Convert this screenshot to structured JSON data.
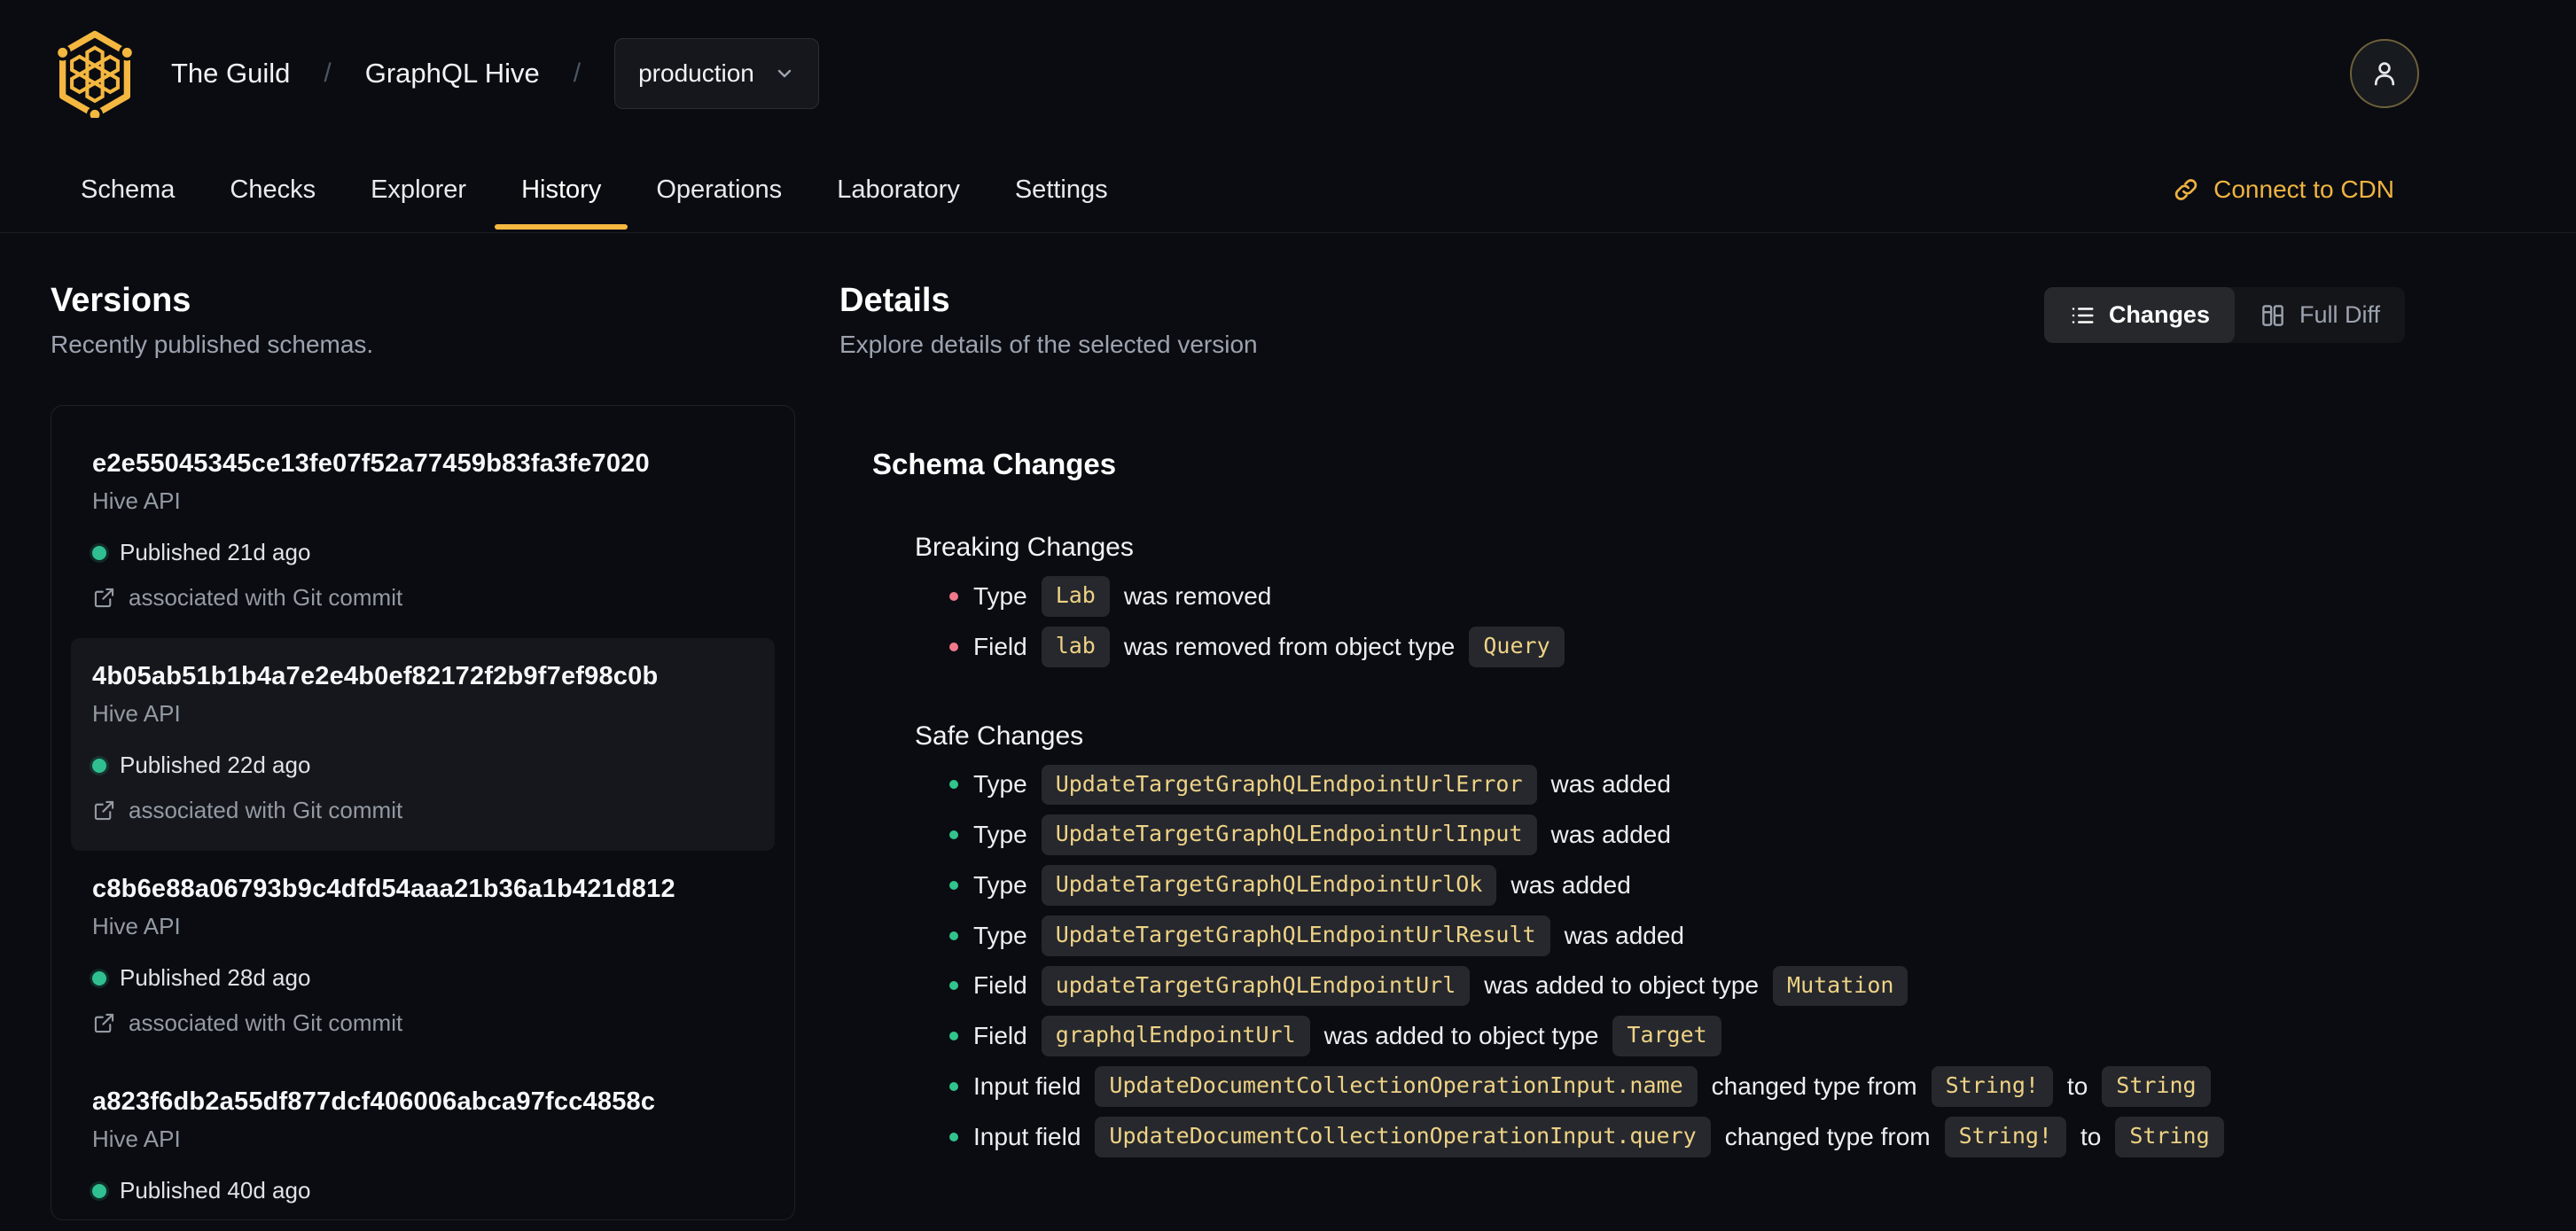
{
  "colors": {
    "accent": "#f4b740",
    "page_background": "#0a0c11",
    "breaking_bullet": "#f0788b",
    "safe_bullet": "#31c48d",
    "published_dot": "#2fbf90",
    "code_text": "#eed285",
    "code_background": "#26282d"
  },
  "header": {
    "breadcrumb": {
      "org": "The Guild",
      "separator": "/",
      "project": "GraphQL Hive",
      "target": "production"
    },
    "tabs": [
      {
        "id": "schema",
        "label": "Schema",
        "active": false
      },
      {
        "id": "checks",
        "label": "Checks",
        "active": false
      },
      {
        "id": "explorer",
        "label": "Explorer",
        "active": false
      },
      {
        "id": "history",
        "label": "History",
        "active": true
      },
      {
        "id": "operations",
        "label": "Operations",
        "active": false
      },
      {
        "id": "laboratory",
        "label": "Laboratory",
        "active": false
      },
      {
        "id": "settings",
        "label": "Settings",
        "active": false
      }
    ],
    "connect_cdn_label": "Connect to CDN"
  },
  "versions_panel": {
    "title": "Versions",
    "subtitle": "Recently published schemas.",
    "items": [
      {
        "hash": "e2e55045345ce13fe07f52a77459b83fa3fe7020",
        "service": "Hive API",
        "published": "Published 21d ago",
        "git": "associated with Git commit",
        "selected": false
      },
      {
        "hash": "4b05ab51b1b4a7e2e4b0ef82172f2b9f7ef98c0b",
        "service": "Hive API",
        "published": "Published 22d ago",
        "git": "associated with Git commit",
        "selected": true
      },
      {
        "hash": "c8b6e88a06793b9c4dfd54aaa21b36a1b421d812",
        "service": "Hive API",
        "published": "Published 28d ago",
        "git": "associated with Git commit",
        "selected": false
      },
      {
        "hash": "a823f6db2a55df877dcf406006abca97fcc4858c",
        "service": "Hive API",
        "published": "Published 40d ago",
        "git": "",
        "selected": false
      }
    ]
  },
  "details_panel": {
    "title": "Details",
    "subtitle": "Explore details of the selected version",
    "view_toggle": {
      "changes_label": "Changes",
      "full_diff_label": "Full Diff",
      "active": "changes"
    },
    "schema_changes": {
      "title": "Schema Changes",
      "sections": [
        {
          "id": "breaking",
          "title": "Breaking Changes",
          "items": [
            {
              "segments": [
                {
                  "t": "text",
                  "v": "Type"
                },
                {
                  "t": "code",
                  "v": "Lab"
                },
                {
                  "t": "text",
                  "v": "was removed"
                }
              ]
            },
            {
              "segments": [
                {
                  "t": "text",
                  "v": "Field"
                },
                {
                  "t": "code",
                  "v": "lab"
                },
                {
                  "t": "text",
                  "v": "was removed from object type"
                },
                {
                  "t": "code",
                  "v": "Query"
                }
              ]
            }
          ]
        },
        {
          "id": "safe",
          "title": "Safe Changes",
          "items": [
            {
              "segments": [
                {
                  "t": "text",
                  "v": "Type"
                },
                {
                  "t": "code",
                  "v": "UpdateTargetGraphQLEndpointUrlError"
                },
                {
                  "t": "text",
                  "v": "was added"
                }
              ]
            },
            {
              "segments": [
                {
                  "t": "text",
                  "v": "Type"
                },
                {
                  "t": "code",
                  "v": "UpdateTargetGraphQLEndpointUrlInput"
                },
                {
                  "t": "text",
                  "v": "was added"
                }
              ]
            },
            {
              "segments": [
                {
                  "t": "text",
                  "v": "Type"
                },
                {
                  "t": "code",
                  "v": "UpdateTargetGraphQLEndpointUrlOk"
                },
                {
                  "t": "text",
                  "v": "was added"
                }
              ]
            },
            {
              "segments": [
                {
                  "t": "text",
                  "v": "Type"
                },
                {
                  "t": "code",
                  "v": "UpdateTargetGraphQLEndpointUrlResult"
                },
                {
                  "t": "text",
                  "v": "was added"
                }
              ]
            },
            {
              "segments": [
                {
                  "t": "text",
                  "v": "Field"
                },
                {
                  "t": "code",
                  "v": "updateTargetGraphQLEndpointUrl"
                },
                {
                  "t": "text",
                  "v": "was added to object type"
                },
                {
                  "t": "code",
                  "v": "Mutation"
                }
              ]
            },
            {
              "segments": [
                {
                  "t": "text",
                  "v": "Field"
                },
                {
                  "t": "code",
                  "v": "graphqlEndpointUrl"
                },
                {
                  "t": "text",
                  "v": "was added to object type"
                },
                {
                  "t": "code",
                  "v": "Target"
                }
              ]
            },
            {
              "segments": [
                {
                  "t": "text",
                  "v": "Input field"
                },
                {
                  "t": "code",
                  "v": "UpdateDocumentCollectionOperationInput.name"
                },
                {
                  "t": "text",
                  "v": "changed type from"
                },
                {
                  "t": "code",
                  "v": "String!"
                },
                {
                  "t": "text",
                  "v": "to"
                },
                {
                  "t": "code",
                  "v": "String"
                }
              ]
            },
            {
              "segments": [
                {
                  "t": "text",
                  "v": "Input field"
                },
                {
                  "t": "code",
                  "v": "UpdateDocumentCollectionOperationInput.query"
                },
                {
                  "t": "text",
                  "v": "changed type from"
                },
                {
                  "t": "code",
                  "v": "String!"
                },
                {
                  "t": "text",
                  "v": "to"
                },
                {
                  "t": "code",
                  "v": "String"
                }
              ]
            }
          ]
        }
      ]
    }
  }
}
